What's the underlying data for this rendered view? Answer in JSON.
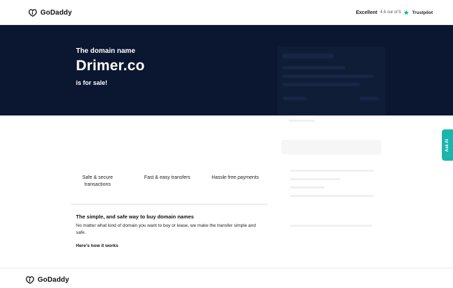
{
  "header": {
    "brand": "GoDaddy",
    "trust": {
      "label": "Excellent",
      "score": "4.6 out of 5",
      "provider": "Trustpilot"
    }
  },
  "hero": {
    "eyebrow": "The domain name",
    "domain": "Drimer.co",
    "tagline": "is for sale!"
  },
  "features": [
    {
      "line1": "Safe & secure",
      "line2": "transactions"
    },
    {
      "line1": "Fast & easy transfers",
      "line2": ""
    },
    {
      "line1": "Hassle free payments",
      "line2": ""
    }
  ],
  "info": {
    "title": "The simple, and safe way to buy domain names",
    "body": "No matter what kind of domain you want to buy or lease, we make the transfer simple and safe.",
    "how_it_works": "Here's how it works"
  },
  "ask_ai": "Ask AI",
  "footer": {
    "brand": "GoDaddy"
  },
  "colors": {
    "hero_bg": "#0b1730",
    "ask_ai_bg": "#1bb5ae",
    "trustpilot_green": "#00b67a"
  }
}
